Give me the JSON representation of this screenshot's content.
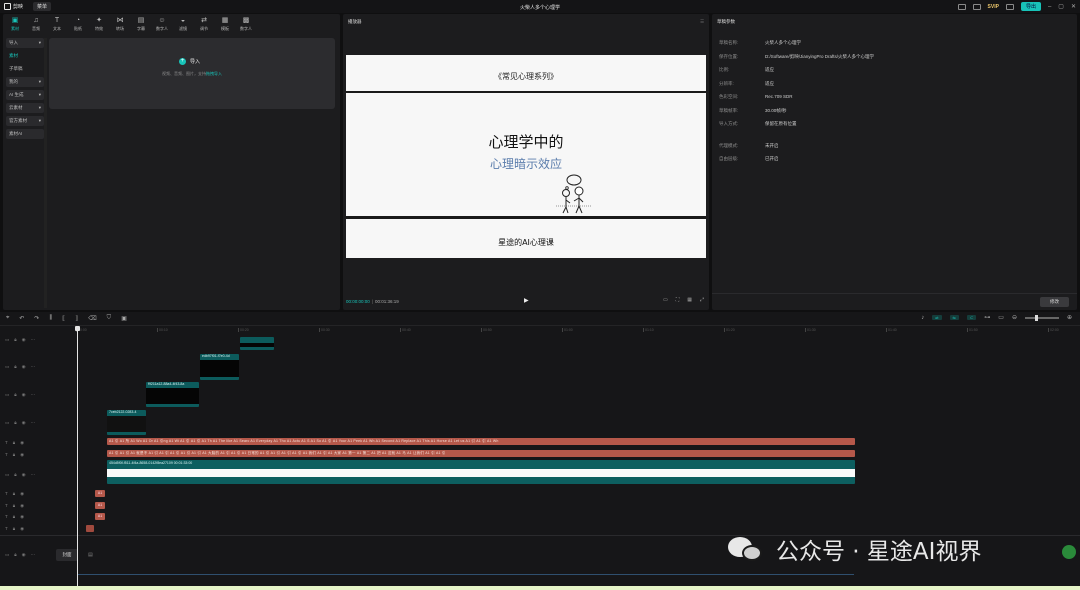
{
  "titlebar": {
    "app_name": "剪映",
    "menu_label": "菜单",
    "window_title": "火柴人多个心理学",
    "svip_label": "SVIP",
    "export_label": "导出"
  },
  "toolbar": {
    "tabs": [
      {
        "label": "素材",
        "glyph": "▣"
      },
      {
        "label": "音频",
        "glyph": "♫"
      },
      {
        "label": "文本",
        "glyph": "T"
      },
      {
        "label": "贴纸",
        "glyph": "◔"
      },
      {
        "label": "特效",
        "glyph": "✦"
      },
      {
        "label": "转场",
        "glyph": "⋈"
      },
      {
        "label": "字幕",
        "glyph": "▤"
      },
      {
        "label": "数字人",
        "glyph": "☺"
      },
      {
        "label": "滤镜",
        "glyph": "◒"
      },
      {
        "label": "调节",
        "glyph": "⇄"
      },
      {
        "label": "模板",
        "glyph": "▦"
      },
      {
        "label": "数字人",
        "glyph": "▩"
      }
    ]
  },
  "side_nav": {
    "items": [
      {
        "label": "导入",
        "arrow": "▾"
      },
      {
        "label": "素材",
        "arrow": ""
      },
      {
        "label": "子草稿",
        "arrow": ""
      },
      {
        "label": "我的",
        "arrow": "▾"
      },
      {
        "label": "AI 生成",
        "arrow": "▾"
      },
      {
        "label": "云素材",
        "arrow": "▾"
      },
      {
        "label": "官方素材",
        "arrow": "▾"
      },
      {
        "label": "素材AI",
        "arrow": ""
      }
    ]
  },
  "import_area": {
    "title": "导入",
    "subtitle": "视频、音频、图片，支持",
    "link": "拖拽导入"
  },
  "player": {
    "header": "播放器",
    "series_label": "《常见心理系列》",
    "main_title": "心理学中的",
    "sub_title": "心理暗示效应",
    "course_label": "星途的AI心理课",
    "time_current": "00:00:00:00",
    "time_total": "00:01:36:19"
  },
  "props": {
    "header": "草稿参数",
    "rows": [
      {
        "key": "草稿名称:",
        "value": "火柴人多个心理学"
      },
      {
        "key": "保存位置:",
        "value": "D:/Software/剪映/JianyingPro Drafts/火柴人多个心理学"
      },
      {
        "key": "比例:",
        "value": "适应"
      },
      {
        "key": "分辨率:",
        "value": "适应"
      },
      {
        "key": "色彩空间:",
        "value": "Rec.709 SDR"
      },
      {
        "key": "草稿帧率:",
        "value": "30.00帧/秒"
      },
      {
        "key": "导入方式:",
        "value": "保留在原有位置"
      }
    ],
    "rows2": [
      {
        "key": "代理模式:",
        "value": "未开启"
      },
      {
        "key": "自由层级:",
        "value": "已开启"
      }
    ],
    "modify_label": "修改"
  },
  "timeline": {
    "ruler": [
      "00:00",
      "00:10",
      "00:20",
      "00:30",
      "00:40",
      "00:50",
      "01:00",
      "01:10",
      "01:20",
      "01:30",
      "01:40",
      "01:50",
      "02:00"
    ],
    "clips": {
      "clip_a": "",
      "clip_b": "edb97f01-f7e0-4d",
      "clip_c": "f9211a12-88a4-4f43-8a",
      "clip_d": "7ceb2122-0283-4"
    },
    "main_clip_label": "454d5f0f-f511-4f4a-8658-0142f8ea27109   00:01:33:00",
    "text_track_1": "A1 引  A1 所  A1 Wo  A1 Or   A1 引ng  A1 Wi  A1 引  A1 引  A1 Th  A1 The like  A1 Searc  A1 Everyday  A1 Tho  A1 Actu  A1 S  A1 So  A1 引  A1 Your  A1 Peek  A1 Wh  A1 Second  A1 Replace  A1 This  A1 Horse  A1 Let us  A1 引  A1 引  A1 Wh",
    "text_track_2": "A1 引  A1 引  A1 就是不  A1 引  A1 引  A1 引  A1 引  A1 引  A1 大脑的  A1 引  A1 引  A1 日常的  A1 引  A1 引  A1 引  A1 引  A1 我们  A1 引  A1 大家  A1 第一  A1 第二  A1 把  A1 这就  A1 马  A1 让我们  A1 引  A1 引",
    "small_text_label": "A1",
    "cover_label": "封面"
  },
  "watermark": {
    "text": "公众号 · 星途AI视界"
  }
}
